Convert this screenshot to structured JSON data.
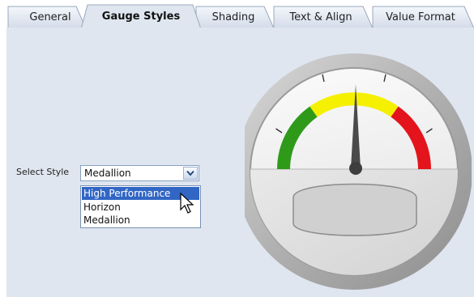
{
  "tabs": [
    {
      "label": "General",
      "active": false
    },
    {
      "label": "Gauge Styles",
      "active": true
    },
    {
      "label": "Shading",
      "active": false
    },
    {
      "label": "Text & Align",
      "active": false
    },
    {
      "label": "Value Format",
      "active": false
    }
  ],
  "style_selector": {
    "label": "Select Style",
    "value": "Medallion",
    "options": [
      "High Performance",
      "Horizon",
      "Medallion"
    ],
    "highlighted": "High Performance"
  },
  "gauge": {
    "bands": [
      {
        "name": "green",
        "color": "#2f9a1a"
      },
      {
        "name": "yellow",
        "color": "#f4f000"
      },
      {
        "name": "red",
        "color": "#e3141b"
      }
    ],
    "needle_color": "#4a4a4a"
  },
  "colors": {
    "content_bg": "#dfe6f0",
    "selection": "#3166c5"
  }
}
